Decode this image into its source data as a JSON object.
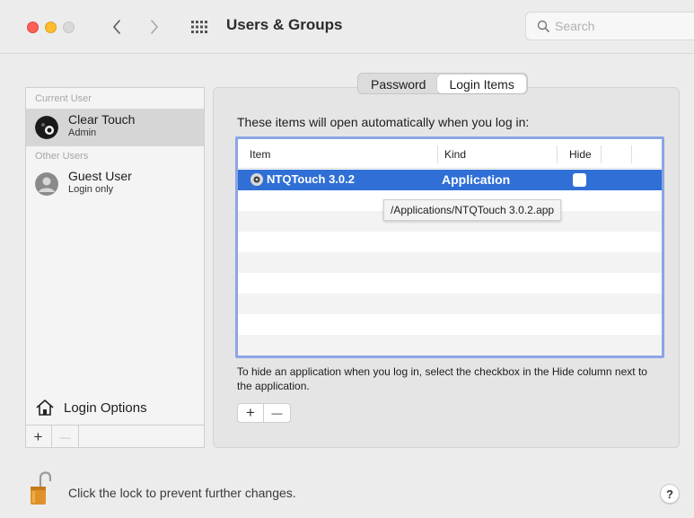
{
  "window": {
    "title": "Users & Groups",
    "search": {
      "placeholder": "Search",
      "value": ""
    }
  },
  "sidebar": {
    "current_user_label": "Current User",
    "current_user": {
      "name": "Clear Touch",
      "role": "Admin"
    },
    "other_users_label": "Other Users",
    "other_users": [
      {
        "name": "Guest User",
        "role": "Login only"
      }
    ],
    "login_options_label": "Login Options",
    "add_label": "+",
    "remove_label": "—"
  },
  "tabs": [
    {
      "label": "Password",
      "active": false
    },
    {
      "label": "Login Items",
      "active": true
    }
  ],
  "login_items": {
    "intro": "These items will open automatically when you log in:",
    "columns": {
      "item": "Item",
      "kind": "Kind",
      "hide": "Hide"
    },
    "rows": [
      {
        "item": "NTQTouch 3.0.2",
        "kind": "Application",
        "hide": false,
        "selected": true
      }
    ],
    "tooltip": "/Applications/NTQTouch 3.0.2.app",
    "hint": "To hide an application when you log in, select the checkbox in the Hide column next to the application.",
    "add_label": "+",
    "remove_label": "—"
  },
  "footer": {
    "lock_text": "Click the lock to prevent further changes.",
    "help_label": "?"
  },
  "colors": {
    "selection": "#2f6fd6",
    "table_focus": "#8ba5e6",
    "close": "#fe5f57",
    "minimize": "#febc2e",
    "lock": "#e0922a"
  },
  "icons": [
    "back-chevron-icon",
    "forward-chevron-icon",
    "grid-icon",
    "search-icon",
    "avatar-icon",
    "home-icon",
    "app-icon",
    "lock-icon",
    "help-icon"
  ]
}
